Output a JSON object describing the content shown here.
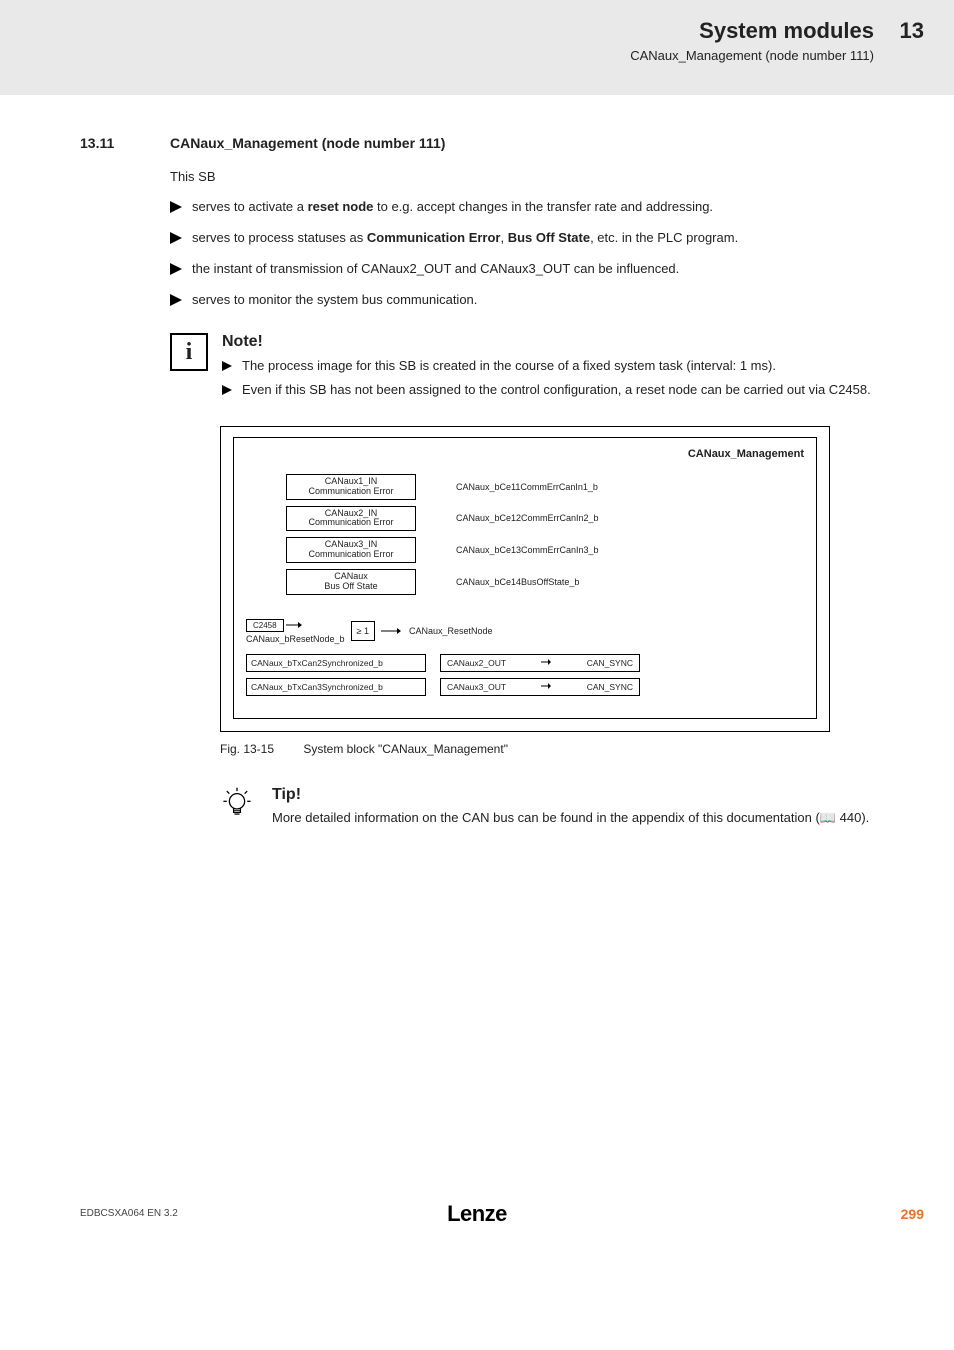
{
  "header": {
    "title": "System modules",
    "subtitle": "CANaux_Management (node number 111)",
    "chapter": "13"
  },
  "section": {
    "number": "13.11",
    "title": "CANaux_Management (node number 111)"
  },
  "intro": "This SB",
  "bullets": [
    {
      "pre": "serves to activate a ",
      "bold": "reset node",
      "post": " to e.g. accept changes in the transfer rate and addressing."
    },
    {
      "pre": "serves to process statuses as ",
      "bold": "Communication Error",
      "mid": ", ",
      "bold2": "Bus Off State",
      "post": ", etc. in the PLC program."
    },
    {
      "pre": "the instant of transmission of CANaux2_OUT and CANaux3_OUT can be influenced."
    },
    {
      "pre": "serves to monitor the system bus communication."
    }
  ],
  "note": {
    "title": "Note!",
    "items": [
      "The process image for this SB is created in the course of a fixed system task (interval: 1 ms).",
      "Even if this SB has not been assigned to the control configuration, a reset node can be carried out via C2458."
    ]
  },
  "diagram": {
    "title": "CANaux_Management",
    "rows": [
      {
        "boxTop": "CANaux1_IN",
        "boxBot": "Communication Error",
        "out": "CANaux_bCe11CommErrCanIn1_b"
      },
      {
        "boxTop": "CANaux2_IN",
        "boxBot": "Communication Error",
        "out": "CANaux_bCe12CommErrCanIn2_b"
      },
      {
        "boxTop": "CANaux3_IN",
        "boxBot": "Communication Error",
        "out": "CANaux_bCe13CommErrCanIn3_b"
      },
      {
        "boxTop": "CANaux",
        "boxBot": "Bus Off State",
        "out": "CANaux_bCe14BusOffState_b"
      }
    ],
    "reset": {
      "code": "C2458",
      "inLabel": "CANaux_bResetNode_b",
      "gate": "≥ 1",
      "outLabel": "CANaux_ResetNode"
    },
    "sync": [
      {
        "in": "CANaux_bTxCan2Synchronized_b",
        "out": "CANaux2_OUT",
        "tag": "CAN_SYNC"
      },
      {
        "in": "CANaux_bTxCan3Synchronized_b",
        "out": "CANaux3_OUT",
        "tag": "CAN_SYNC"
      }
    ]
  },
  "figure": {
    "num": "Fig. 13-15",
    "caption": "System block \"CANaux_Management\""
  },
  "tip": {
    "title": "Tip!",
    "text_pre": "More detailed information on the CAN bus can be found in the appendix of this documentation (",
    "page_ref": "440",
    "text_post": ")."
  },
  "footer": {
    "left": "EDBCSXA064 EN 3.2",
    "logo": "Lenze",
    "right": "299"
  }
}
